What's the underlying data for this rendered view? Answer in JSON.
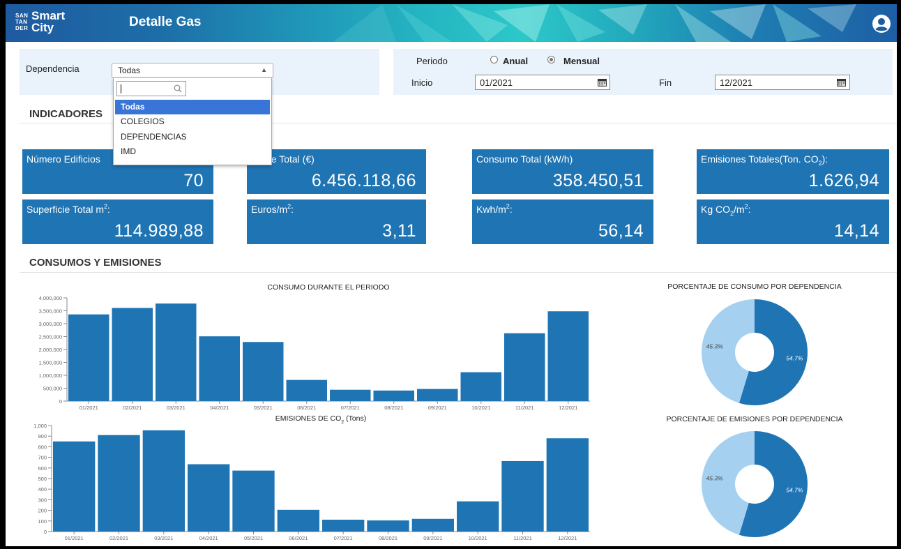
{
  "header": {
    "logo_small_1": "SAN",
    "logo_small_2": "TAN",
    "logo_small_3": "DER",
    "logo_line1": "Smart",
    "logo_line2": "City",
    "title": "Detalle Gas"
  },
  "filters": {
    "dependencia_label": "Dependencia",
    "dependencia_value": "Todas",
    "dependencia_options": [
      "Todas",
      "COLEGIOS",
      "DEPENDENCIAS",
      "IMD"
    ],
    "periodo_label": "Periodo",
    "anual_label": "Anual",
    "mensual_label": "Mensual",
    "periodo_selected": "Mensual",
    "inicio_label": "Inicio",
    "inicio_value": "01/2021",
    "fin_label": "Fin",
    "fin_value": "12/2021"
  },
  "sections": {
    "indicadores": "INDICADORES",
    "consumos": "CONSUMOS Y EMISIONES"
  },
  "cards": [
    {
      "label": "Número Edificios",
      "value": "70"
    },
    {
      "label": "Coste Total (€)",
      "value": "6.456.118,66"
    },
    {
      "label": "Consumo Total (kW/h)",
      "value": "358.450,51"
    },
    {
      "label_html": "Emisiones Totales(Ton. CO<sub class='s'>2</sub>):",
      "value": "1.626,94"
    },
    {
      "label_html": "Superficie Total m<sup class='s'>2</sup>:",
      "value": "114.989,88"
    },
    {
      "label_html": "Euros/m<sup class='s'>2</sup>:",
      "value": "3,11"
    },
    {
      "label_html": "Kwh/m<sup class='s'>2</sup>:",
      "value": "56,14"
    },
    {
      "label_html": "Kg CO<sub class='s'>2</sub>/m<sup class='s'>2</sup>:",
      "value": "14,14"
    }
  ],
  "colors": {
    "primary": "#1f74b4",
    "light": "#a6d0f0",
    "header_dark": "#1e5aa0",
    "header_light": "#2cc8c8",
    "filter_bg": "#eaf3fb"
  },
  "icons": {
    "user": "user-circle-icon",
    "search": "search-icon",
    "calendar": "calendar-icon",
    "caret": "caret-up-icon"
  },
  "chart_data": [
    {
      "type": "bar",
      "title": "CONSUMO DURANTE EL PERIODO",
      "categories": [
        "01/2021",
        "02/2021",
        "03/2021",
        "04/2021",
        "05/2021",
        "06/2021",
        "07/2021",
        "08/2021",
        "09/2021",
        "10/2021",
        "11/2021",
        "12/2021"
      ],
      "values": [
        3360000,
        3610000,
        3780000,
        2510000,
        2290000,
        820000,
        440000,
        410000,
        470000,
        1120000,
        2630000,
        3480000
      ],
      "ylim": [
        0,
        4000000
      ],
      "yticks": [
        "0",
        "500,000",
        "1,000,000",
        "1,500,000",
        "2,000,000",
        "2,500,000",
        "3,000,000",
        "3,500,000",
        "4,000,000"
      ],
      "color": "#1f74b4"
    },
    {
      "type": "bar",
      "title_html": "EMISIONES DE CO<tspan baseline-shift='sub' font-size='7'>2</tspan> (Tons)",
      "categories": [
        "01/2021",
        "02/2021",
        "03/2021",
        "04/2021",
        "05/2021",
        "06/2021",
        "07/2021",
        "08/2021",
        "09/2021",
        "10/2021",
        "11/2021",
        "12/2021"
      ],
      "values": [
        850,
        910,
        955,
        635,
        575,
        205,
        112,
        105,
        120,
        285,
        665,
        880
      ],
      "ylim": [
        0,
        1000
      ],
      "yticks": [
        "0",
        "100",
        "200",
        "300",
        "400",
        "500",
        "600",
        "700",
        "800",
        "900",
        "1,000"
      ],
      "color": "#1f74b4"
    },
    {
      "type": "pie",
      "title": "PORCENTAJE DE CONSUMO POR DEPENDENCIA",
      "slices": [
        {
          "value": 54.7,
          "label": "54.7%",
          "color": "#1f74b4"
        },
        {
          "value": 45.3,
          "label": "45.3%",
          "color": "#a6d0f0"
        }
      ]
    },
    {
      "type": "pie",
      "title": "PORCENTAJE DE EMISIONES POR DEPENDENCIA",
      "slices": [
        {
          "value": 54.7,
          "label": "54.7%",
          "color": "#1f74b4"
        },
        {
          "value": 45.3,
          "label": "45.3%",
          "color": "#a6d0f0"
        }
      ]
    }
  ]
}
